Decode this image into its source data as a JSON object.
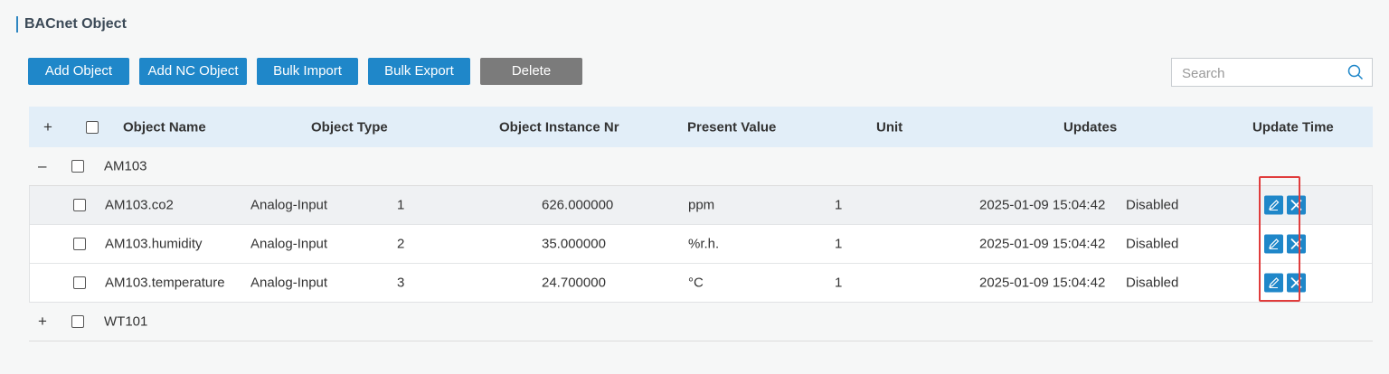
{
  "page": {
    "title": "BACnet Object"
  },
  "toolbar": {
    "add_object": "Add Object",
    "add_nc_object": "Add NC Object",
    "bulk_import": "Bulk Import",
    "bulk_export": "Bulk Export",
    "delete": "Delete"
  },
  "search": {
    "placeholder": "Search",
    "icon": "search-icon"
  },
  "table": {
    "expand_symbol": "+",
    "collapse_symbol": "–",
    "headers": {
      "object_name": "Object Name",
      "object_type": "Object Type",
      "object_instance_nr": "Object Instance Nr",
      "present_value": "Present Value",
      "unit": "Unit",
      "updates": "Updates",
      "update_time": "Update Time"
    },
    "groups": [
      {
        "name": "AM103",
        "expanded": true,
        "rows": [
          {
            "name": "AM103.co2",
            "type": "Analog-Input",
            "instance": "1",
            "value": "626.000000",
            "unit": "ppm",
            "updates": "1",
            "time": "2025-01-09 15:04:42",
            "status": "Disabled"
          },
          {
            "name": "AM103.humidity",
            "type": "Analog-Input",
            "instance": "2",
            "value": "35.000000",
            "unit": "%r.h.",
            "updates": "1",
            "time": "2025-01-09 15:04:42",
            "status": "Disabled"
          },
          {
            "name": "AM103.temperature",
            "type": "Analog-Input",
            "instance": "3",
            "value": "24.700000",
            "unit": "°C",
            "updates": "1",
            "time": "2025-01-09 15:04:42",
            "status": "Disabled"
          }
        ]
      },
      {
        "name": "WT101",
        "expanded": false
      }
    ]
  },
  "colors": {
    "primary": "#1f87c9",
    "disabled_button": "#7b7b7b",
    "header_bg": "#e2eef8",
    "highlight": "#e03c3c"
  }
}
